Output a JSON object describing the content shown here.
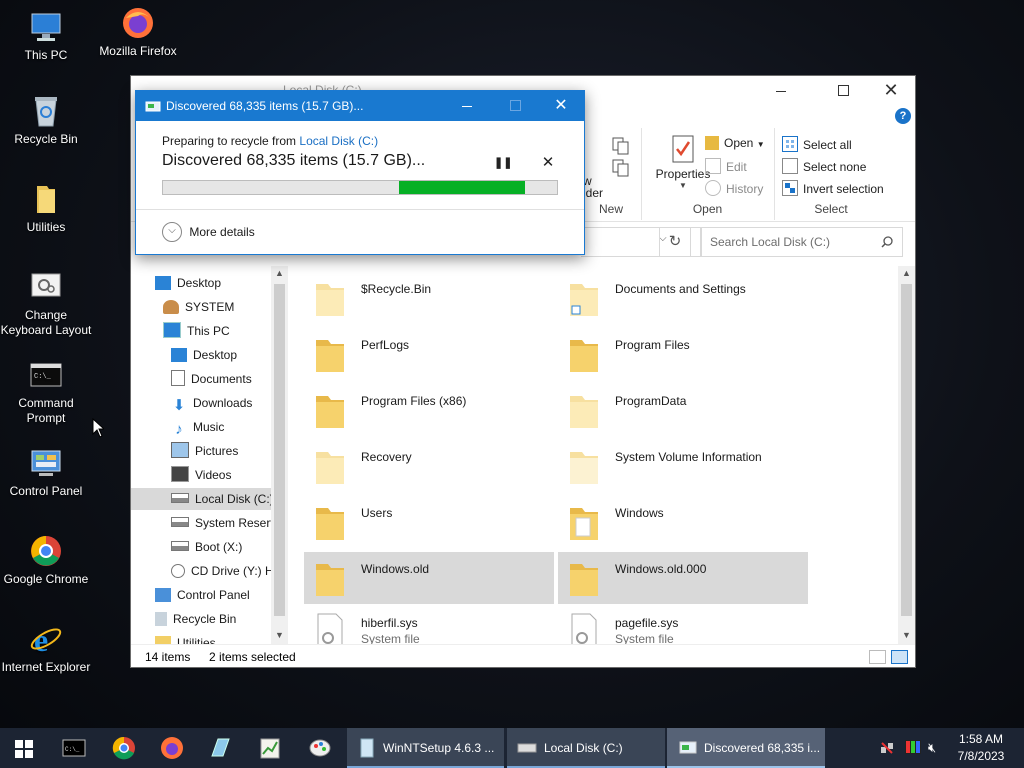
{
  "desktop": {
    "icons": [
      {
        "label": "This PC"
      },
      {
        "label": "Mozilla Firefox"
      },
      {
        "label": "Recycle Bin"
      },
      {
        "label": "Utilities"
      },
      {
        "label": "Change Keyboard Layout"
      },
      {
        "label": "Command Prompt"
      },
      {
        "label": "Control Panel"
      },
      {
        "label": "Google Chrome"
      },
      {
        "label": "Internet Explorer"
      }
    ]
  },
  "explorer": {
    "title": "Local Disk (C:)",
    "ribbon": {
      "new_group": "New",
      "new_folder_partial_1": "w",
      "new_folder_partial_2": "lder",
      "properties": "Properties",
      "open": "Open",
      "edit": "Edit",
      "history": "History",
      "open_group": "Open",
      "select_all": "Select all",
      "select_none": "Select none",
      "invert_selection": "Invert selection",
      "select_group": "Select"
    },
    "search_placeholder": "Search Local Disk (C:)",
    "nav": [
      {
        "label": "Desktop"
      },
      {
        "label": "SYSTEM"
      },
      {
        "label": "This PC"
      },
      {
        "label": "Desktop"
      },
      {
        "label": "Documents"
      },
      {
        "label": "Downloads"
      },
      {
        "label": "Music"
      },
      {
        "label": "Pictures"
      },
      {
        "label": "Videos"
      },
      {
        "label": "Local Disk (C:)"
      },
      {
        "label": "System Reserve"
      },
      {
        "label": "Boot (X:)"
      },
      {
        "label": "CD Drive (Y:) H"
      },
      {
        "label": "Control Panel"
      },
      {
        "label": "Recycle Bin"
      },
      {
        "label": "Utilities"
      }
    ],
    "items": [
      {
        "name": "$Recycle.Bin"
      },
      {
        "name": "Documents and Settings"
      },
      {
        "name": "PerfLogs"
      },
      {
        "name": "Program Files"
      },
      {
        "name": "Program Files (x86)"
      },
      {
        "name": "ProgramData"
      },
      {
        "name": "Recovery"
      },
      {
        "name": "System Volume Information"
      },
      {
        "name": "Users"
      },
      {
        "name": "Windows"
      },
      {
        "name": "Windows.old"
      },
      {
        "name": "Windows.old.000"
      },
      {
        "name": "hiberfil.sys",
        "sub": "System file"
      },
      {
        "name": "pagefile.sys",
        "sub": "System file"
      }
    ],
    "status": {
      "count": "14 items",
      "selected": "2 items selected"
    }
  },
  "dialog": {
    "title": "Discovered 68,335 items (15.7 GB)...",
    "preparing_prefix": "Preparing to recycle from ",
    "preparing_link": "Local Disk (C:)",
    "headline": "Discovered 68,335 items (15.7 GB)...",
    "progress_start": 0.6,
    "progress_end": 0.92,
    "more_details": "More details"
  },
  "taskbar": {
    "buttons": [
      {
        "label": "WinNTSetup 4.6.3 ..."
      },
      {
        "label": "Local Disk (C:)"
      },
      {
        "label": "Discovered 68,335 i..."
      }
    ],
    "time": "1:58 AM",
    "date": "7/8/2023"
  },
  "colors": {
    "accent": "#1979d0",
    "progress": "#06b025",
    "taskbar": "#1c2433"
  }
}
